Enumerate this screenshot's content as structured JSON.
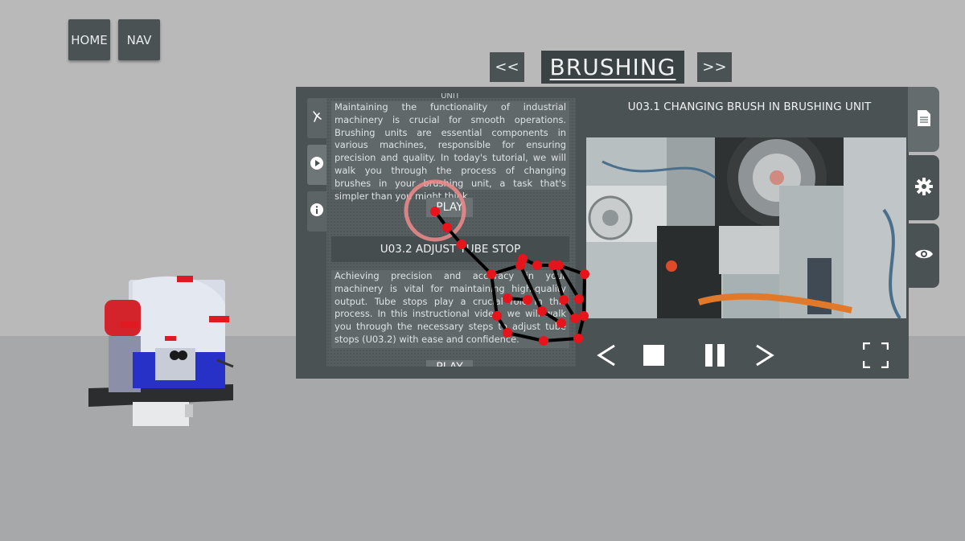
{
  "top_nav": {
    "home_label": "HOME",
    "nav_label": "NAV"
  },
  "header": {
    "prev_label": "<<",
    "title": "BRUSHING",
    "next_label": ">>"
  },
  "list": {
    "items": [
      {
        "title_fragment": "UNIT",
        "description": "Maintaining the functionality of industrial machinery is crucial for smooth operations. Brushing units are essential components in various machines, responsible for ensuring precision and quality. In today's tutorial, we will walk you through the process of changing brushes in your brushing unit, a task that's simpler than you might think.",
        "play_label": "PLAY"
      },
      {
        "title": "U03.2 ADJUST TUBE STOP",
        "description": "Achieving precision and accuracy in your machinery is vital for maintaining high-quality output. Tube stops play a crucial role in this process. In this instructional video, we will walk you through the necessary steps to adjust tube stops (U03.2) with ease and confidence.",
        "play_label": "PLAY"
      }
    ]
  },
  "video": {
    "title": "U03.1 CHANGING BRUSH IN BRUSHING UNIT"
  },
  "side_tabs": [
    "tools-icon",
    "play-circle-icon",
    "info-icon"
  ],
  "right_tabs": [
    "document-icon",
    "gear-icon",
    "eye-icon"
  ],
  "controls": [
    "previous-icon",
    "stop-icon",
    "pause-icon",
    "next-icon",
    "fullscreen-icon"
  ],
  "colors": {
    "panel": "#4a5254",
    "hand_joint": "#e8141b",
    "cursor_ring": "#f08b8b"
  }
}
